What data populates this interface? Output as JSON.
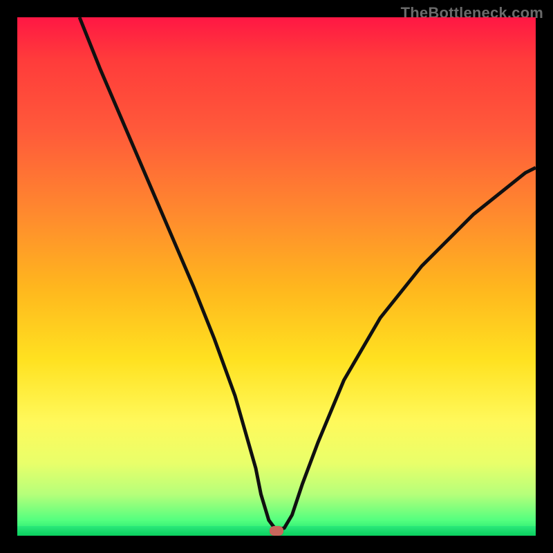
{
  "watermark": "TheBottleneck.com",
  "colors": {
    "frame_bg": "#000000",
    "gradient_top": "#ff1744",
    "gradient_mid1": "#ff8a2e",
    "gradient_mid2": "#ffe120",
    "gradient_bottom": "#14e36e",
    "curve": "#101010",
    "marker": "#c9665c",
    "watermark_color": "#6a6a6a"
  },
  "chart_data": {
    "type": "line",
    "title": "",
    "xlabel": "",
    "ylabel": "",
    "xlim": [
      0,
      100
    ],
    "ylim": [
      0,
      100
    ],
    "grid": false,
    "legend_position": "none",
    "series": [
      {
        "name": "bottleneck-curve",
        "x": [
          12,
          16,
          22,
          28,
          34,
          38,
          42,
          44,
          46,
          47,
          48.5,
          50,
          51.5,
          53,
          55,
          58,
          63,
          70,
          78,
          88,
          98,
          100
        ],
        "values": [
          100,
          90,
          76,
          62,
          48,
          38,
          27,
          20,
          13,
          8,
          3,
          1,
          1.5,
          4,
          10,
          18,
          30,
          42,
          52,
          62,
          70,
          71
        ]
      }
    ],
    "annotations": [
      {
        "name": "optimal-marker",
        "x": 50,
        "y": 1
      }
    ]
  }
}
